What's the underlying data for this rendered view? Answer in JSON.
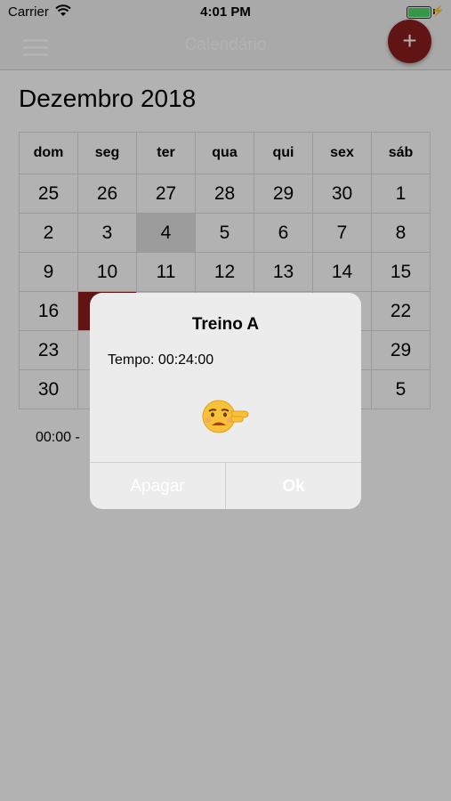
{
  "status_bar": {
    "carrier": "Carrier",
    "time": "4:01 PM"
  },
  "nav": {
    "title": "Calendário",
    "add_label": "+"
  },
  "calendar": {
    "month_title": "Dezembro 2018",
    "weekdays": [
      "dom",
      "seg",
      "ter",
      "qua",
      "qui",
      "sex",
      "sáb"
    ],
    "weeks": [
      [
        "25",
        "26",
        "27",
        "28",
        "29",
        "30",
        "1"
      ],
      [
        "2",
        "3",
        "4",
        "5",
        "6",
        "7",
        "8"
      ],
      [
        "9",
        "10",
        "11",
        "12",
        "13",
        "14",
        "15"
      ],
      [
        "16",
        "",
        "",
        "",
        "",
        "",
        "22"
      ],
      [
        "23",
        "",
        "",
        "",
        "",
        "",
        "29"
      ],
      [
        "30",
        "",
        "",
        "",
        "",
        "",
        "5"
      ]
    ],
    "highlighted_day": "4",
    "marked_color": "#8b1d1d"
  },
  "events": {
    "first_line": "00:00 -"
  },
  "alert": {
    "title": "Treino A",
    "message": "Tempo: 00:24:00",
    "emoji_icon": "tired-face-pointing-icon",
    "delete_label": "Apagar",
    "ok_label": "Ok"
  },
  "colors": {
    "accent": "#8b1d1d",
    "overlay": "rgba(0,0,0,0.30)"
  }
}
